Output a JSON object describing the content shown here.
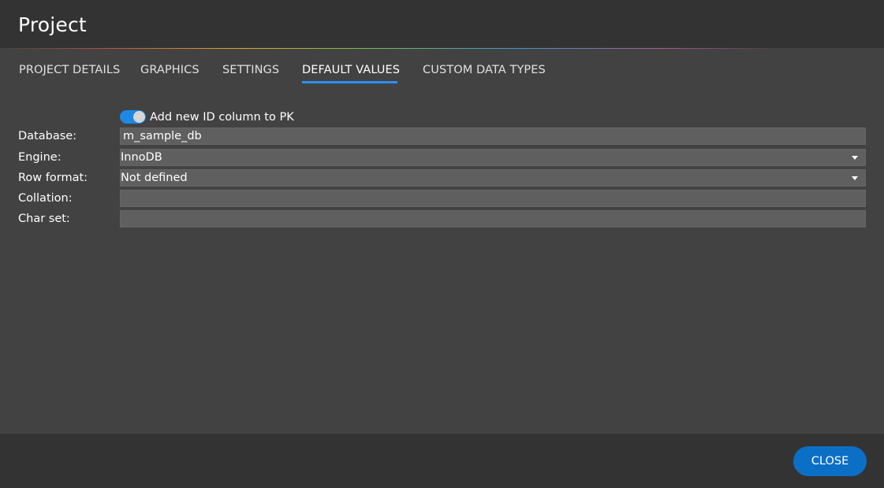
{
  "dialog": {
    "title": "Project"
  },
  "tabs": [
    {
      "label": "PROJECT DETAILS",
      "active": false
    },
    {
      "label": "GRAPHICS",
      "active": false
    },
    {
      "label": "SETTINGS",
      "active": false
    },
    {
      "label": "DEFAULT VALUES",
      "active": true
    },
    {
      "label": "CUSTOM DATA TYPES",
      "active": false
    }
  ],
  "defaults": {
    "toggle": {
      "label": "Add new ID column to PK",
      "checked": true
    },
    "database": {
      "label": "Database:",
      "value": "m_sample_db"
    },
    "engine": {
      "label": "Engine:",
      "value": "InnoDB"
    },
    "row_format": {
      "label": "Row format:",
      "value": "Not defined"
    },
    "collation": {
      "label": "Collation:",
      "value": ""
    },
    "char_set": {
      "label": "Char set:",
      "value": ""
    }
  },
  "footer": {
    "close_label": "CLOSE"
  },
  "colors": {
    "accent": "#1e88e5",
    "button": "#0c6fc6",
    "background": "#424242",
    "header": "#333333",
    "field": "#5f5f5f"
  },
  "icons": {
    "select_caret": "chevron-down-icon"
  }
}
